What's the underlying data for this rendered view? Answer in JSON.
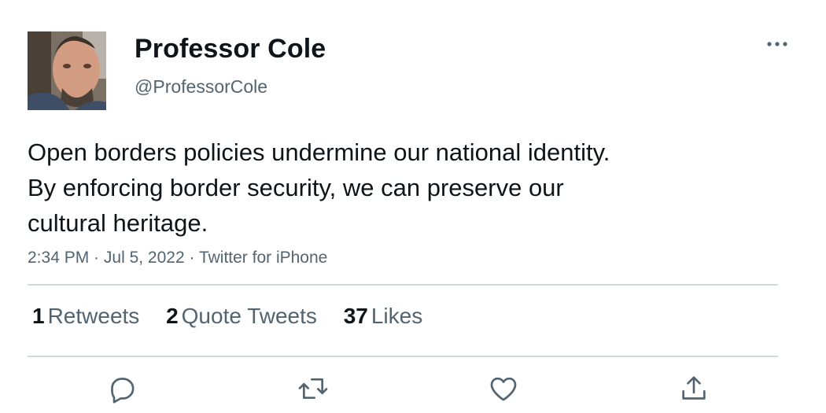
{
  "author": {
    "display_name": "Professor Cole",
    "handle": "@ProfessorCole"
  },
  "tweet": {
    "text_lines": [
      "Open borders policies undermine our national identity.",
      "By enforcing border security, we can preserve our",
      "cultural heritage."
    ],
    "time": "2:34 PM",
    "date": "Jul 5, 2022",
    "source": "Twitter for iPhone",
    "separator": " · "
  },
  "stats": {
    "retweets": {
      "count": "1",
      "label": "Retweets"
    },
    "quotes": {
      "count": "2",
      "label": "Quote Tweets"
    },
    "likes": {
      "count": "37",
      "label": "Likes"
    }
  },
  "icons": {
    "more": "more-horizontal-icon",
    "reply": "reply-icon",
    "retweet": "retweet-icon",
    "like": "heart-icon",
    "share": "share-icon"
  },
  "colors": {
    "text": "#0f1419",
    "secondary": "#536471",
    "divider": "#cfd9de"
  }
}
